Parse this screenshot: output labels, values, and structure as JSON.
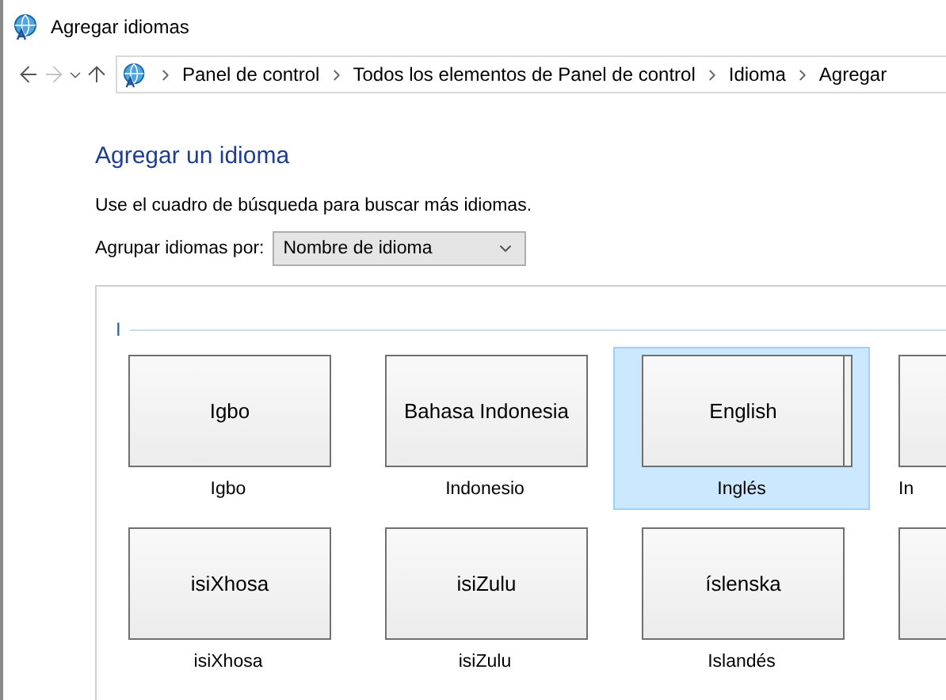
{
  "window": {
    "title": "Agregar idiomas"
  },
  "nav_buttons": [
    {
      "kind": "back",
      "disabled": false
    },
    {
      "kind": "forward",
      "disabled": true
    },
    {
      "kind": "recent",
      "disabled": false
    },
    {
      "kind": "up",
      "disabled": false
    }
  ],
  "breadcrumbs": [
    "Panel de control",
    "Todos los elementos de Panel de control",
    "Idioma",
    "Agregar"
  ],
  "heading": "Agregar un idioma",
  "hint": "Use el cuadro de búsqueda para buscar más idiomas.",
  "group_by": {
    "label": "Agrupar idiomas por:",
    "value": "Nombre de idioma"
  },
  "group_header": "I",
  "rows": [
    [
      {
        "tile": "Igbo",
        "label": "Igbo",
        "selected": false,
        "stacked": false
      },
      {
        "tile": "Bahasa Indonesia",
        "label": "Indonesio",
        "selected": false,
        "stacked": false
      },
      {
        "tile": "English",
        "label": "Inglés",
        "selected": true,
        "stacked": true
      },
      {
        "label": "In",
        "selected": false
      }
    ],
    [
      {
        "tile": "isiXhosa",
        "label": "isiXhosa",
        "selected": false,
        "stacked": false
      },
      {
        "tile": "isiZulu",
        "label": "isiZulu",
        "selected": false,
        "stacked": false
      },
      {
        "tile": "íslenska",
        "label": "Islandés",
        "selected": false,
        "stacked": false
      },
      {
        "selected": false
      }
    ]
  ]
}
